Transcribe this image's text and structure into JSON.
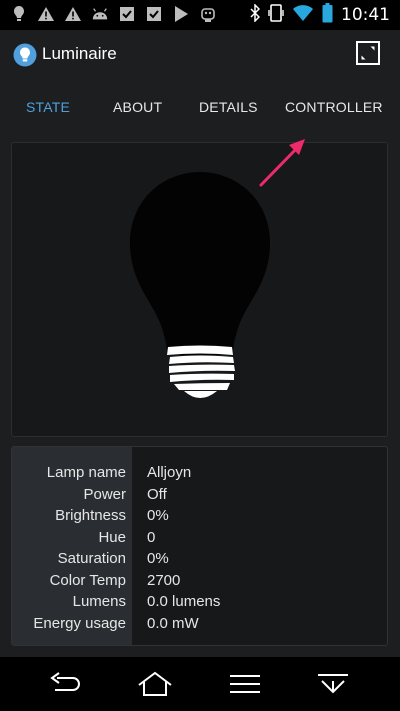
{
  "status_bar": {
    "time": "10:41",
    "left_icons": [
      "lightbulb-icon",
      "warning-icon",
      "warning-icon",
      "android-icon",
      "checkbox-icon",
      "checkbox-icon",
      "play-store-icon",
      "robot-icon"
    ],
    "right_icons": [
      "bluetooth-icon",
      "vibrate-icon",
      "wifi-icon",
      "battery-icon"
    ]
  },
  "app": {
    "title": "Luminaire"
  },
  "tabs": [
    {
      "label": "STATE",
      "active": true
    },
    {
      "label": "ABOUT",
      "active": false
    },
    {
      "label": "DETAILS",
      "active": false
    },
    {
      "label": "CONTROLLER",
      "active": false
    }
  ],
  "lamp_info": [
    {
      "label": "Lamp name",
      "value": "Alljoyn"
    },
    {
      "label": "Power",
      "value": "Off"
    },
    {
      "label": "Brightness",
      "value": "0%"
    },
    {
      "label": "Hue",
      "value": "0"
    },
    {
      "label": "Saturation",
      "value": "0%"
    },
    {
      "label": "Color Temp",
      "value": "2700"
    },
    {
      "label": "Lumens",
      "value": "0.0 lumens"
    },
    {
      "label": "Energy usage",
      "value": "0.0 mW"
    }
  ],
  "colors": {
    "accent": "#4fa0dc",
    "annotation_arrow": "#ee2a6b",
    "background": "#1c1e20"
  }
}
